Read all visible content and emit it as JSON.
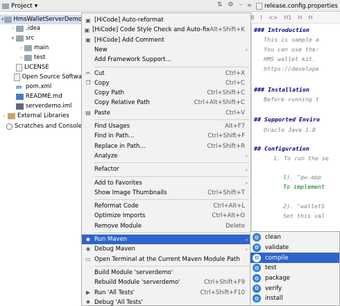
{
  "project_header": {
    "title": "Project",
    "dropdown_icon": "chevron-down-icon",
    "icons": [
      "split-icon",
      "gear-icon",
      "minimize-icon"
    ]
  },
  "tree": [
    {
      "label": "HmsWalletServerDemo",
      "icon": "folder",
      "indent": 0,
      "arrow": "▾",
      "selected": true
    },
    {
      "label": ".idea",
      "icon": "folder",
      "indent": 1,
      "arrow": "›",
      "selected": false
    },
    {
      "label": "src",
      "icon": "folder",
      "indent": 1,
      "arrow": "▾",
      "selected": false
    },
    {
      "label": "main",
      "icon": "folder",
      "indent": 2,
      "arrow": "›",
      "selected": false
    },
    {
      "label": "test",
      "icon": "folder",
      "indent": 2,
      "arrow": "›",
      "selected": false
    },
    {
      "label": "LICENSE",
      "icon": "file",
      "indent": 1,
      "arrow": "",
      "selected": false
    },
    {
      "label": "Open Source Softwa",
      "icon": "file",
      "indent": 1,
      "arrow": "",
      "selected": false
    },
    {
      "label": "pom.xml",
      "icon": "maven",
      "indent": 1,
      "arrow": "",
      "selected": false
    },
    {
      "label": "README.md",
      "icon": "md",
      "indent": 1,
      "arrow": "",
      "selected": false
    },
    {
      "label": "serverdemo.iml",
      "icon": "iml",
      "indent": 1,
      "arrow": "",
      "selected": false
    },
    {
      "label": "External Libraries",
      "icon": "lib",
      "indent": 0,
      "arrow": "›",
      "selected": false
    },
    {
      "label": "Scratches and Console",
      "icon": "scratch",
      "indent": 0,
      "arrow": "",
      "selected": false
    }
  ],
  "editor": {
    "tab_nav": "≡",
    "tab_label": "release.config.properties",
    "tab_close": "×",
    "md_toolbar": [
      "B",
      "I",
      "<>",
      "H1",
      "H",
      "H"
    ],
    "lines": [
      {
        "text": "### Introduction",
        "style": "h",
        "indent": 0
      },
      {
        "text": "This is sample a",
        "style": "t",
        "indent": 1
      },
      {
        "text": "You can use the:",
        "style": "t",
        "indent": 1
      },
      {
        "text": "HMS wallet kit.",
        "style": "t",
        "indent": 1
      },
      {
        "text": "https://develope",
        "style": "t",
        "indent": 1
      },
      {
        "text": "### Installation",
        "style": "h",
        "indent": 0
      },
      {
        "text": "Before running t",
        "style": "t",
        "indent": 1
      },
      {
        "text": "## Supported Enviro",
        "style": "h",
        "indent": 0
      },
      {
        "text": "Oracle Java 1.8",
        "style": "t",
        "indent": 1
      },
      {
        "text": "## Configuration",
        "style": "h",
        "indent": 0
      },
      {
        "text": "1. To run the se",
        "style": "t",
        "indent": 2
      },
      {
        "text": "1). \"gw.app",
        "style": "t",
        "indent": 3
      },
      {
        "text": "To implement",
        "style": "s",
        "indent": 3
      },
      {
        "text": "2). \"walletS",
        "style": "t",
        "indent": 3
      },
      {
        "text": "Set this val",
        "style": "t",
        "indent": 3
      }
    ]
  },
  "context_menu": {
    "items": [
      {
        "type": "item",
        "icon": "hicode-icon",
        "glyph": "▣",
        "label": "[HiCode] Auto-reformat",
        "shortcut": "",
        "submenu": false
      },
      {
        "type": "item",
        "icon": "hicode-icon",
        "glyph": "▣",
        "label": "[HiCode] Code Style Check and Auto-fix",
        "shortcut": "Alt+Shift+K",
        "submenu": false
      },
      {
        "type": "item",
        "icon": "hicode-icon",
        "glyph": "▣",
        "label": "[HiCode] Add Comment",
        "shortcut": "",
        "submenu": false
      },
      {
        "type": "item",
        "icon": "",
        "glyph": "",
        "label": "New",
        "shortcut": "",
        "submenu": true
      },
      {
        "type": "item",
        "icon": "",
        "glyph": "",
        "label": "Add Framework Support...",
        "shortcut": "",
        "submenu": false
      },
      {
        "type": "sep"
      },
      {
        "type": "item",
        "icon": "scissors-icon",
        "glyph": "✂",
        "label": "Cut",
        "shortcut": "Ctrl+X",
        "submenu": false
      },
      {
        "type": "item",
        "icon": "copy-icon",
        "glyph": "❐",
        "label": "Copy",
        "shortcut": "Ctrl+C",
        "submenu": false
      },
      {
        "type": "item",
        "icon": "",
        "glyph": "",
        "label": "Copy Path",
        "shortcut": "Ctrl+Shift+C",
        "submenu": false
      },
      {
        "type": "item",
        "icon": "",
        "glyph": "",
        "label": "Copy Relative Path",
        "shortcut": "Ctrl+Alt+Shift+C",
        "submenu": false
      },
      {
        "type": "item",
        "icon": "clipboard-icon",
        "glyph": "▤",
        "label": "Paste",
        "shortcut": "Ctrl+V",
        "submenu": false
      },
      {
        "type": "sep"
      },
      {
        "type": "item",
        "icon": "",
        "glyph": "",
        "label": "Find Usages",
        "shortcut": "Alt+F7",
        "submenu": false
      },
      {
        "type": "item",
        "icon": "",
        "glyph": "",
        "label": "Find in Path...",
        "shortcut": "Ctrl+Shift+F",
        "submenu": false
      },
      {
        "type": "item",
        "icon": "",
        "glyph": "",
        "label": "Replace in Path...",
        "shortcut": "Ctrl+Shift+R",
        "submenu": false
      },
      {
        "type": "item",
        "icon": "",
        "glyph": "",
        "label": "Analyze",
        "shortcut": "",
        "submenu": true
      },
      {
        "type": "sep"
      },
      {
        "type": "item",
        "icon": "",
        "glyph": "",
        "label": "Refactor",
        "shortcut": "",
        "submenu": true
      },
      {
        "type": "sep"
      },
      {
        "type": "item",
        "icon": "",
        "glyph": "",
        "label": "Add to Favorites",
        "shortcut": "",
        "submenu": true
      },
      {
        "type": "item",
        "icon": "",
        "glyph": "",
        "label": "Show Image Thumbnails",
        "shortcut": "Ctrl+Shift+T",
        "submenu": false
      },
      {
        "type": "sep"
      },
      {
        "type": "item",
        "icon": "",
        "glyph": "",
        "label": "Reformat Code",
        "shortcut": "Ctrl+Alt+L",
        "submenu": false
      },
      {
        "type": "item",
        "icon": "",
        "glyph": "",
        "label": "Optimize Imports",
        "shortcut": "Ctrl+Alt+O",
        "submenu": false
      },
      {
        "type": "item",
        "icon": "",
        "glyph": "",
        "label": "Remove Module",
        "shortcut": "Delete",
        "submenu": false
      },
      {
        "type": "sep"
      },
      {
        "type": "item",
        "icon": "maven-gear-icon",
        "glyph": "✱",
        "label": "Run Maven",
        "shortcut": "",
        "submenu": true,
        "highlighted": true
      },
      {
        "type": "item",
        "icon": "maven-debug-icon",
        "glyph": "✱",
        "label": "Debug Maven",
        "shortcut": "",
        "submenu": true
      },
      {
        "type": "item",
        "icon": "terminal-icon",
        "glyph": "▭",
        "label": "Open Terminal at the Current Maven Module Path",
        "shortcut": "",
        "submenu": false
      },
      {
        "type": "sep"
      },
      {
        "type": "item",
        "icon": "",
        "glyph": "",
        "label": "Build Module 'serverdemo'",
        "shortcut": "",
        "submenu": false
      },
      {
        "type": "item",
        "icon": "",
        "glyph": "",
        "label": "Rebuild Module 'serverdemo'",
        "shortcut": "Ctrl+Shift+F9",
        "submenu": false
      },
      {
        "type": "item",
        "icon": "run-icon",
        "glyph": "▶",
        "label": "Run 'All Tests'",
        "shortcut": "Ctrl+Shift+F10",
        "submenu": false
      },
      {
        "type": "item",
        "icon": "debug-icon",
        "glyph": "✹",
        "label": "Debug 'All Tests'",
        "shortcut": "",
        "submenu": false
      }
    ]
  },
  "maven_submenu": {
    "items": [
      {
        "label": "clean",
        "highlighted": false
      },
      {
        "label": "validate",
        "highlighted": false
      },
      {
        "label": "compile",
        "highlighted": true
      },
      {
        "label": "test",
        "highlighted": false
      },
      {
        "label": "package",
        "highlighted": false
      },
      {
        "label": "verify",
        "highlighted": false
      },
      {
        "label": "install",
        "highlighted": false
      }
    ]
  },
  "colors": {
    "highlight": "#2f65ca",
    "menu_bg": "#f2f2f2",
    "tree_selected": "#d5e0f0",
    "md_heading": "#000080",
    "md_text": "#808080",
    "md_string": "#007a00"
  }
}
